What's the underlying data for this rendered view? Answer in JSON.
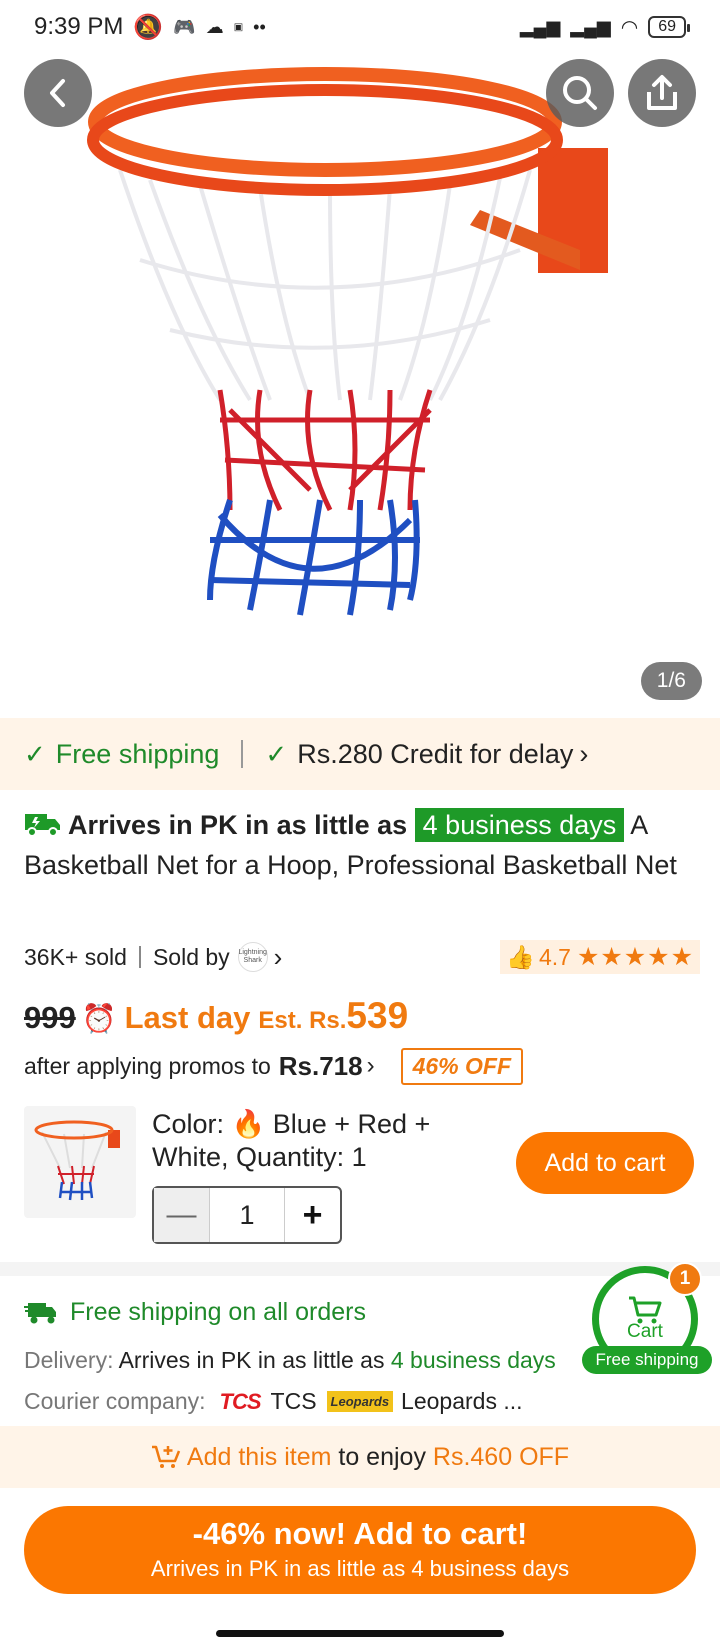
{
  "status_bar": {
    "time": "9:39 PM",
    "battery": "69"
  },
  "gallery": {
    "counter": "1/6"
  },
  "shipping_strip": {
    "free_shipping": "Free shipping",
    "credit": "Rs.280 Credit for delay"
  },
  "product": {
    "arrives_prefix": "Arrives in PK in as little as",
    "days_badge": "4 business days",
    "title": "A Basketball Net for a Hoop, Professional Basketball Net",
    "sold": "36K+ sold",
    "sold_by": "Sold by",
    "seller_logo_text": "Lightning Shark",
    "rating": "4.7",
    "stars": "★★★★★"
  },
  "price": {
    "old": "999",
    "last_day": "Last day",
    "est": "Est. Rs.",
    "current": "539",
    "promo_text": "after applying promos to",
    "promo_price": "Rs.718",
    "off_badge": "46% OFF"
  },
  "sku": {
    "label": "Color:",
    "value": "Blue + Red + White, Quantity: 1",
    "quantity": "1",
    "add_to_cart": "Add to cart"
  },
  "shipping_info": {
    "free_all": "Free shipping on all orders",
    "delivery_label": "Delivery:",
    "delivery_text": "Arrives in PK in as little as",
    "delivery_days": "4 business days",
    "courier_label": "Courier company:",
    "tcs_logo": "TCS",
    "tcs": "TCS",
    "leopards_logo": "Leopards",
    "leopards": "Leopards ..."
  },
  "cart_float": {
    "label": "Cart",
    "count": "1",
    "free": "Free shipping"
  },
  "add_item_bar": {
    "lead": "Add this item",
    "middle": "to enjoy",
    "amount": "Rs.460 OFF"
  },
  "cta": {
    "main": "-46% now! Add to cart!",
    "sub": "Arrives in PK in as little as 4 business days"
  },
  "colors": {
    "accent": "#fb7701",
    "green": "#1f8a2a"
  }
}
